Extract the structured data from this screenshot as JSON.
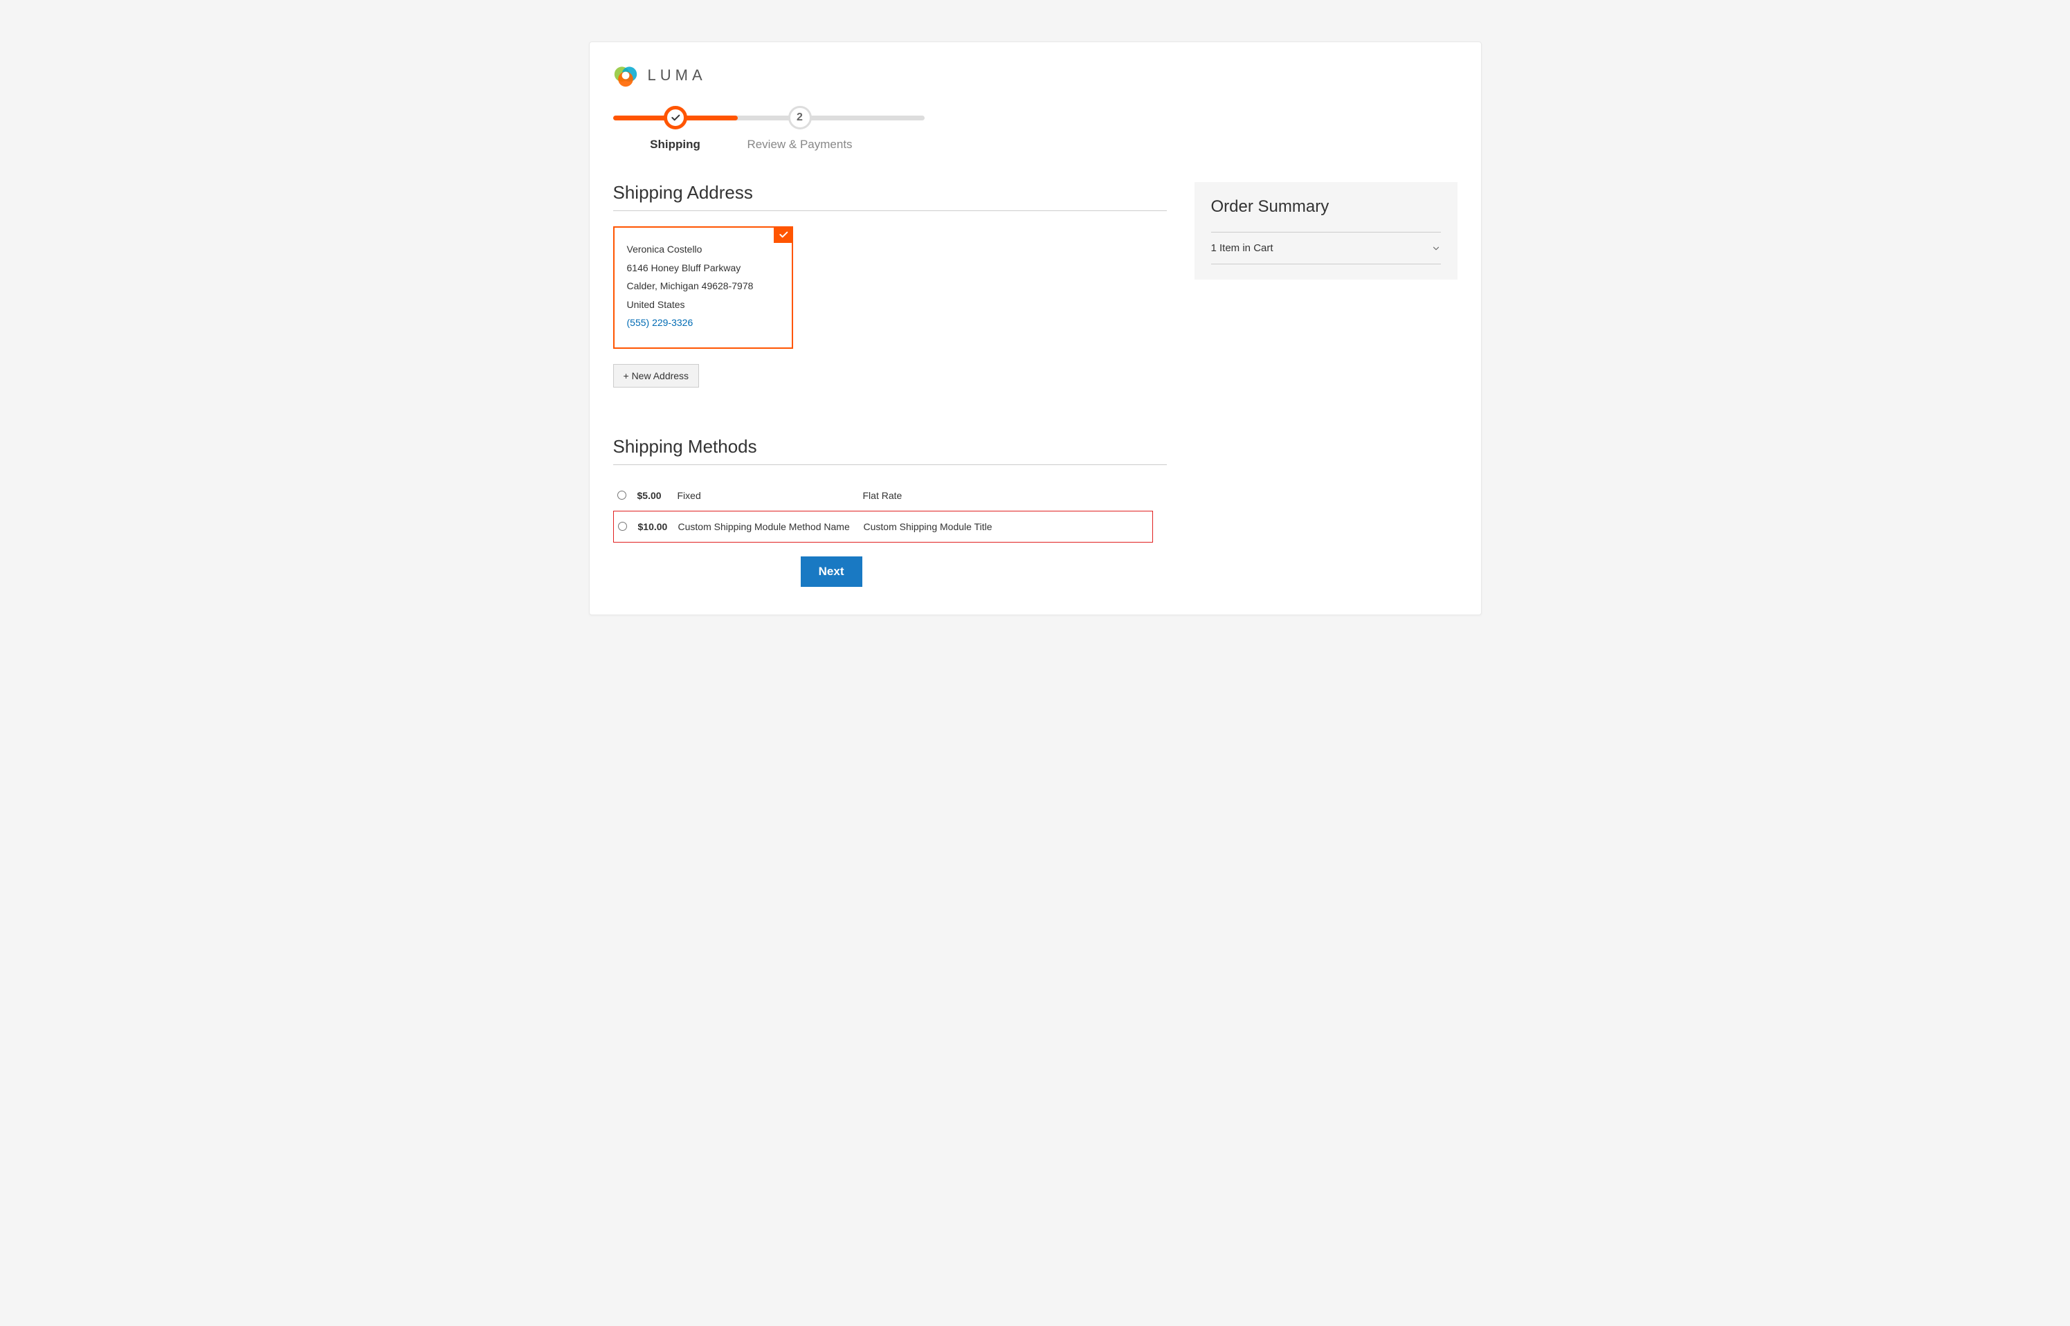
{
  "logo": {
    "text": "LUMA"
  },
  "progress": {
    "steps": [
      {
        "label": "Shipping",
        "state": "done"
      },
      {
        "label": "Review & Payments",
        "num": "2",
        "state": "pending"
      }
    ]
  },
  "shipping": {
    "title": "Shipping Address",
    "address": {
      "name": "Veronica Costello",
      "street": "6146 Honey Bluff Parkway",
      "city_line": "Calder, Michigan 49628-7978",
      "country": "United States",
      "phone": "(555) 229-3326"
    },
    "new_address_btn": "+ New Address"
  },
  "methods": {
    "title": "Shipping Methods",
    "rows": [
      {
        "price": "$5.00",
        "method": "Fixed",
        "carrier": "Flat Rate",
        "highlight": false
      },
      {
        "price": "$10.00",
        "method": "Custom Shipping Module Method Name",
        "carrier": "Custom Shipping Module Title",
        "highlight": true
      }
    ]
  },
  "next_btn": "Next",
  "summary": {
    "title": "Order Summary",
    "items_line": "1 Item in Cart"
  }
}
